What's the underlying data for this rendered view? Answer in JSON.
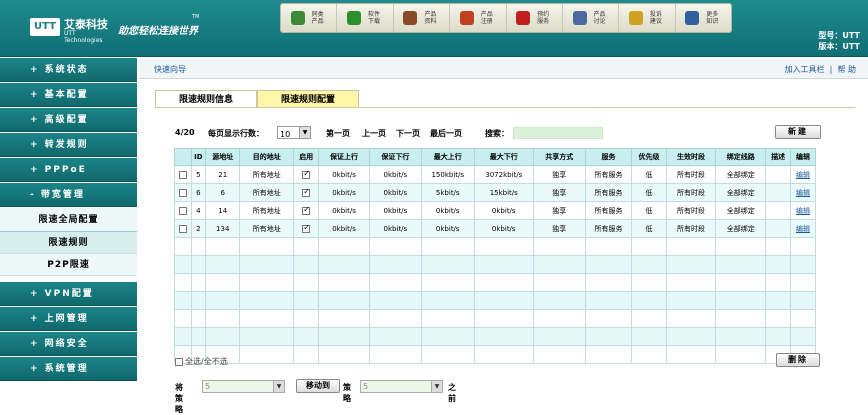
{
  "header": {
    "logo_mark": "UTT",
    "logo_cn": "艾泰科技",
    "logo_en": "UTT Technologies",
    "slogan": "助您轻松连接世界",
    "tm": "TM",
    "model_label": "型号：UTT",
    "version_label": "版本：UTT",
    "nav": [
      {
        "l1": "同类",
        "l2": "产品",
        "icon": "magnifier-icon",
        "color": "#3a8a3a"
      },
      {
        "l1": "软件",
        "l2": "下载",
        "icon": "download-arrow-icon",
        "color": "#2f8f2f"
      },
      {
        "l1": "产品",
        "l2": "资料",
        "icon": "books-icon",
        "color": "#8a4a2a"
      },
      {
        "l1": "产品",
        "l2": "注册",
        "icon": "register-card-icon",
        "color": "#c04020"
      },
      {
        "l1": "预约",
        "l2": "服务",
        "icon": "phone-icon",
        "color": "#c02020"
      },
      {
        "l1": "产品",
        "l2": "讨论",
        "icon": "discussion-people-icon",
        "color": "#4a6aa0"
      },
      {
        "l1": "投诉",
        "l2": "建议",
        "icon": "suggestion-person-icon",
        "color": "#d0a020"
      },
      {
        "l1": "更多",
        "l2": "知识",
        "icon": "knowledge-icon",
        "color": "#3060a0"
      }
    ]
  },
  "sidebar": {
    "items_top": [
      "+ 系统状态",
      "+ 基本配置",
      "+ 高级配置",
      "+ 转发规则",
      "+ PPPoE",
      "- 带宽管理"
    ],
    "subs": [
      "限速全局配置",
      "限速规则",
      "P2P限速"
    ],
    "items_bottom": [
      "+ VPN配置",
      "+ 上网管理",
      "+ 网络安全",
      "+ 系统管理"
    ]
  },
  "subbar": {
    "quick": "快速向导",
    "add_toolbar": "加入工具栏",
    "separator": "|",
    "help": "帮 助"
  },
  "tabs": {
    "active": "限速规则信息",
    "inactive": "限速规则配置"
  },
  "controls": {
    "count": "4/20",
    "rows_label": "每页显示行数：",
    "rows_value": "10",
    "first": "第一页",
    "prev": "上一页",
    "next": "下一页",
    "last": "最后一页",
    "search_label": "搜索：",
    "new_button": "新建"
  },
  "table": {
    "headers": [
      "",
      "ID",
      "源地址",
      "目的地址",
      "启用",
      "保证上行",
      "保证下行",
      "最大上行",
      "最大下行",
      "共享方式",
      "服务",
      "优先级",
      "生效时段",
      "绑定线路",
      "描述",
      "编辑"
    ],
    "rows": [
      {
        "id": "5",
        "src": "21",
        "dst": "所有地址",
        "gu": "0kbit/s",
        "gd": "0kbit/s",
        "mu": "150kbit/s",
        "md": "3072kbit/s",
        "share": "独享",
        "svc": "所有服务",
        "pri": "低",
        "time": "所有时段",
        "line": "全部绑定",
        "desc": "",
        "edit": "编辑"
      },
      {
        "id": "6",
        "src": "6",
        "dst": "所有地址",
        "gu": "0kbit/s",
        "gd": "0kbit/s",
        "mu": "5kbit/s",
        "md": "15kbit/s",
        "share": "独享",
        "svc": "所有服务",
        "pri": "低",
        "time": "所有时段",
        "line": "全部绑定",
        "desc": "",
        "edit": "编辑"
      },
      {
        "id": "4",
        "src": "14",
        "dst": "所有地址",
        "gu": "0kbit/s",
        "gd": "0kbit/s",
        "mu": "0kbit/s",
        "md": "0kbit/s",
        "share": "独享",
        "svc": "所有服务",
        "pri": "低",
        "time": "所有时段",
        "line": "全部绑定",
        "desc": "",
        "edit": "编辑"
      },
      {
        "id": "2",
        "src": "134",
        "dst": "所有地址",
        "gu": "0kbit/s",
        "gd": "0kbit/s",
        "mu": "0kbit/s",
        "md": "0kbit/s",
        "share": "独享",
        "svc": "所有服务",
        "pri": "低",
        "time": "所有时段",
        "line": "全部绑定",
        "desc": "",
        "edit": "编辑"
      }
    ]
  },
  "bottom": {
    "select_all": "全选/全不选",
    "delete_button": "删除",
    "move_label": "将策略",
    "move_from": "5",
    "move_button": "移动到",
    "policy_label": "策略",
    "move_to": "5",
    "before_label": "之前"
  }
}
